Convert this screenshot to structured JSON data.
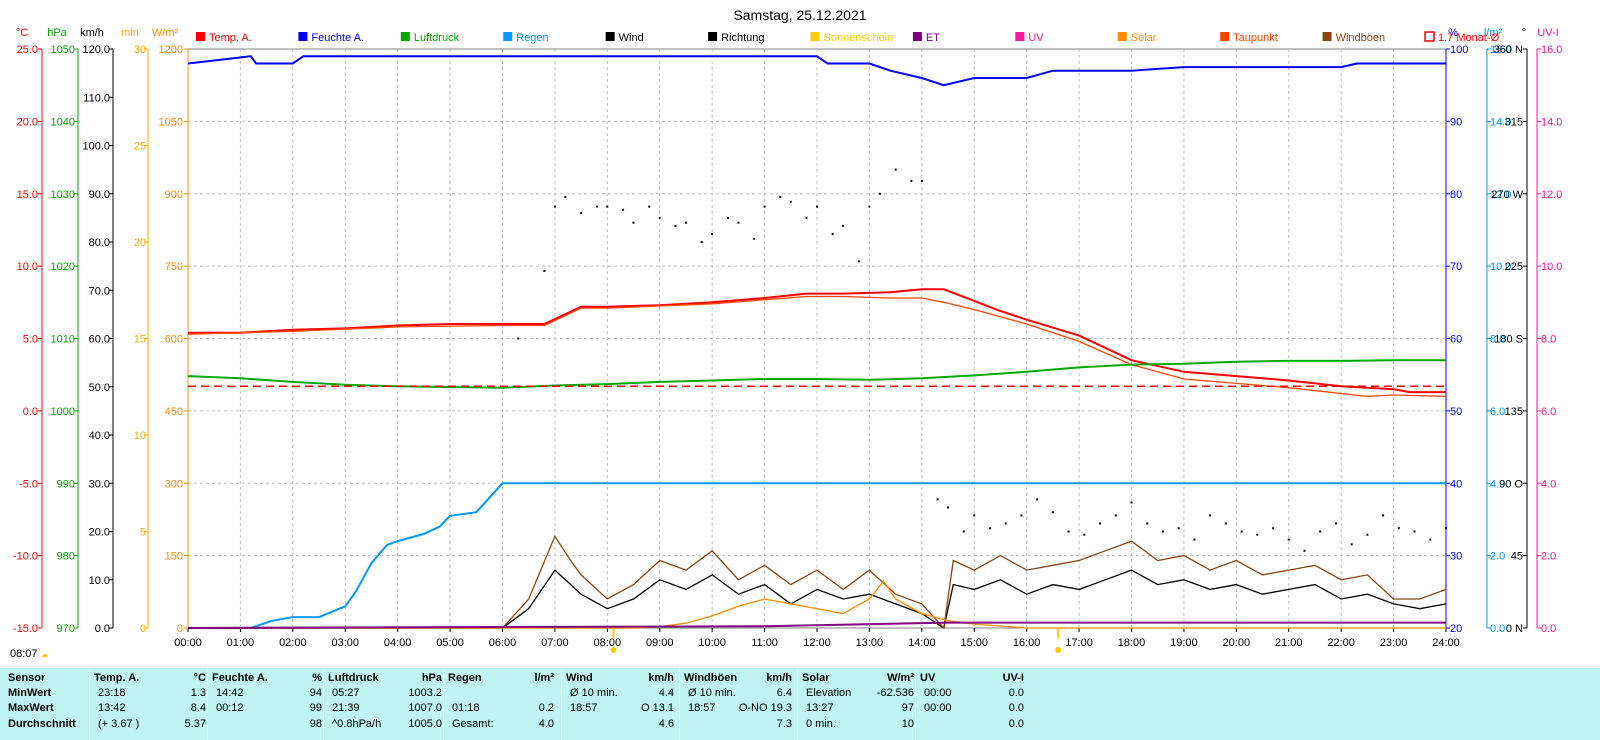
{
  "title": "Samstag, 25.12.2021",
  "sunrise_time": "08:07",
  "legend": [
    {
      "label": "Temp. A.",
      "color": "#ff0000",
      "type": "filled"
    },
    {
      "label": "Feuchte A.",
      "color": "#0000ff",
      "type": "filled"
    },
    {
      "label": "Luftdruck",
      "color": "#00aa00",
      "type": "filled"
    },
    {
      "label": "Regen",
      "color": "#0099ff",
      "type": "filled"
    },
    {
      "label": "Wind",
      "color": "#000000",
      "type": "filled"
    },
    {
      "label": "Richtung",
      "color": "#000000",
      "type": "filled"
    },
    {
      "label": "Sonnenschein",
      "color": "#ffcc00",
      "type": "filled"
    },
    {
      "label": "ET",
      "color": "#800080",
      "type": "filled"
    },
    {
      "label": "UV",
      "color": "#ff1493",
      "type": "filled"
    },
    {
      "label": "Solar",
      "color": "#ff8c00",
      "type": "filled"
    },
    {
      "label": "Taupunkt",
      "color": "#ff4500",
      "type": "filled"
    },
    {
      "label": "Windböen",
      "color": "#8b4513",
      "type": "filled"
    },
    {
      "label": "1.7 Monat-Ø",
      "color": "#ff0000",
      "type": "open"
    }
  ],
  "axes": {
    "temp": {
      "unit": "°C",
      "color": "#ff0000",
      "ticks": [
        "25.0",
        "20.0",
        "15.0",
        "10.0",
        "5.0",
        "0.0",
        "-5.0",
        "-10.0",
        "-15.0"
      ]
    },
    "pressure": {
      "unit": "hPa",
      "color": "#00aa00",
      "ticks": [
        "1050",
        "1040",
        "1030",
        "1020",
        "1010",
        "1000",
        "990",
        "980",
        "970"
      ]
    },
    "wind": {
      "unit": "km/h",
      "color": "#000000",
      "ticks": [
        "120.0",
        "110.0",
        "100.0",
        "90.0",
        "80.0",
        "70.0",
        "60.0",
        "50.0",
        "40.0",
        "30.0",
        "20.0",
        "10.0",
        "0.0"
      ]
    },
    "sunmin": {
      "unit": "min",
      "color": "#ffaa00",
      "ticks": [
        "30",
        "25",
        "20",
        "15",
        "10",
        "5",
        "0"
      ]
    },
    "solar": {
      "unit": "W/m²",
      "color": "#ff8c00",
      "ticks": [
        "1200",
        "1050",
        "900",
        "750",
        "600",
        "450",
        "300",
        "150",
        "0"
      ]
    },
    "humidity": {
      "unit": "%",
      "color": "#0000ff",
      "ticks": [
        "100",
        "90",
        "80",
        "70",
        "60",
        "50",
        "40",
        "30",
        "20"
      ]
    },
    "rain": {
      "unit": "l/m²",
      "color": "#0099ff",
      "ticks": [
        "16.0",
        "14.0",
        "12.0",
        "10.0",
        "8.0",
        "6.0",
        "4.0",
        "2.0",
        "0.0"
      ]
    },
    "direction": {
      "unit": "°",
      "color": "#000000",
      "ticks": [
        "360 N",
        "315",
        "270 W",
        "225",
        "180 S",
        "135",
        "90 O",
        "45",
        "0 N"
      ]
    },
    "uvi": {
      "unit": "UV-I",
      "color": "#ff1493",
      "ticks": [
        "16.0",
        "14.0",
        "12.0",
        "10.0",
        "8.0",
        "6.0",
        "4.0",
        "2.0",
        "0.0"
      ]
    }
  },
  "chart_data": {
    "type": "line",
    "x_labels": [
      "00:00",
      "01:00",
      "02:00",
      "03:00",
      "04:00",
      "05:00",
      "06:00",
      "07:00",
      "08:00",
      "09:00",
      "10:00",
      "11:00",
      "12:00",
      "13:00",
      "14:00",
      "15:00",
      "16:00",
      "17:00",
      "18:00",
      "19:00",
      "20:00",
      "21:00",
      "22:00",
      "23:00",
      "24:00"
    ],
    "xlim": [
      0,
      24
    ],
    "series": [
      {
        "name": "Temp. A.",
        "unit": "°C",
        "color": "#ff0000",
        "x": [
          0,
          1,
          2,
          3,
          4,
          5,
          6,
          6.8,
          7.5,
          8,
          9,
          10,
          11,
          11.8,
          12.5,
          13.4,
          14.0,
          14.42,
          15,
          15.5,
          16,
          17,
          18,
          19,
          20,
          21,
          22,
          23,
          23.3,
          24
        ],
        "y": [
          5.4,
          5.4,
          5.6,
          5.7,
          5.9,
          6.0,
          6.0,
          6.0,
          7.2,
          7.2,
          7.3,
          7.5,
          7.8,
          8.1,
          8.1,
          8.2,
          8.4,
          8.4,
          7.6,
          6.9,
          6.3,
          5.2,
          3.5,
          2.7,
          2.4,
          2.1,
          1.7,
          1.5,
          1.3,
          1.3
        ]
      },
      {
        "name": "Taupunkt",
        "unit": "°C",
        "color": "#ff4500",
        "x": [
          0,
          2,
          4,
          6,
          6.8,
          7.5,
          8,
          10,
          11.8,
          12.5,
          13.4,
          14.0,
          14.42,
          15,
          16,
          17,
          18,
          19,
          20,
          21,
          22,
          22.5,
          23,
          24
        ],
        "y": [
          5.3,
          5.5,
          5.8,
          5.9,
          5.9,
          7.1,
          7.1,
          7.4,
          7.9,
          7.9,
          7.8,
          7.8,
          7.5,
          7.0,
          6.0,
          4.8,
          3.2,
          2.2,
          1.9,
          1.6,
          1.2,
          1.0,
          1.1,
          1.0
        ]
      },
      {
        "name": "Feuchte A.",
        "unit": "%",
        "color": "#0000ff",
        "x": [
          0,
          1.2,
          1.3,
          2.0,
          2.2,
          3,
          4,
          5,
          6,
          7,
          8,
          9,
          10,
          11,
          12,
          12.2,
          13,
          13.4,
          14,
          14.42,
          15,
          16,
          16.5,
          17,
          18,
          19,
          20,
          21,
          22,
          22.3,
          23,
          24
        ],
        "y": [
          98,
          99,
          98,
          98,
          99,
          99,
          99,
          99,
          99,
          99,
          99,
          99,
          99,
          99,
          99,
          98,
          98,
          97,
          96,
          95,
          96,
          96,
          97,
          97,
          97,
          97.5,
          97.5,
          97.5,
          97.5,
          98,
          98,
          98
        ]
      },
      {
        "name": "Luftdruck",
        "unit": "hPa",
        "color": "#00aa00",
        "x": [
          0,
          1,
          2,
          3,
          4,
          5,
          6,
          7,
          8,
          9,
          10,
          11,
          12,
          13,
          14,
          15,
          16,
          17,
          18,
          19,
          20,
          21,
          22,
          23,
          24
        ],
        "y": [
          1004.8,
          1004.5,
          1004.0,
          1003.6,
          1003.4,
          1003.3,
          1003.2,
          1003.5,
          1003.7,
          1004.0,
          1004.2,
          1004.4,
          1004.4,
          1004.3,
          1004.5,
          1004.9,
          1005.4,
          1006.0,
          1006.4,
          1006.5,
          1006.8,
          1006.9,
          1006.9,
          1007.0,
          1007.0
        ]
      },
      {
        "name": "1.7 Monat-Ø",
        "unit": "°C",
        "color": "#ff0000",
        "style": "dashed",
        "x": [
          0,
          24
        ],
        "y": [
          1.7,
          1.7
        ]
      },
      {
        "name": "Regen",
        "unit": "l/m²",
        "color": "#0099ff",
        "x": [
          0,
          1,
          1.2,
          1.6,
          2.0,
          2.5,
          3.0,
          3.2,
          3.5,
          3.8,
          4.0,
          4.5,
          4.8,
          5.0,
          5.5,
          6.0,
          24
        ],
        "y": [
          0,
          0,
          0.0,
          0.2,
          0.3,
          0.3,
          0.6,
          1.0,
          1.8,
          2.3,
          2.4,
          2.6,
          2.8,
          3.1,
          3.2,
          4.0,
          4.0
        ]
      },
      {
        "name": "Wind",
        "unit": "km/h",
        "color": "#000000",
        "x": [
          0,
          6,
          6.5,
          7,
          7.5,
          8,
          8.5,
          9,
          9.5,
          10,
          10.5,
          11,
          11.5,
          12,
          12.5,
          13,
          13.5,
          14,
          14.42,
          14.6,
          15,
          15.5,
          16,
          16.5,
          17,
          17.5,
          18,
          18.5,
          19,
          19.5,
          20,
          20.5,
          21,
          21.5,
          22,
          22.5,
          23,
          23.5,
          24
        ],
        "y": [
          0,
          0,
          4,
          12,
          7,
          4,
          6,
          10,
          8,
          11,
          7,
          9,
          5,
          8,
          6,
          7,
          5,
          3,
          0,
          9,
          8,
          10,
          7,
          9,
          8,
          10,
          12,
          9,
          10,
          8,
          9,
          7,
          8,
          9,
          6,
          7,
          5,
          4,
          5
        ]
      },
      {
        "name": "Windböen",
        "unit": "km/h",
        "color": "#8b4513",
        "x": [
          0,
          6,
          6.5,
          7,
          7.3,
          7.5,
          8,
          8.5,
          9,
          9.5,
          10,
          10.5,
          11,
          11.5,
          12,
          12.5,
          13,
          13.5,
          14,
          14.42,
          14.6,
          15,
          15.5,
          16,
          16.5,
          17,
          17.5,
          18,
          18.5,
          19,
          19.5,
          20,
          20.5,
          21,
          21.5,
          22,
          22.5,
          23,
          23.5,
          24
        ],
        "y": [
          0,
          0,
          6,
          19,
          14,
          11,
          6,
          9,
          14,
          12,
          16,
          10,
          13,
          9,
          12,
          8,
          12,
          7,
          5,
          0,
          14,
          12,
          15,
          12,
          13,
          14,
          16,
          18,
          14,
          15,
          12,
          14,
          11,
          12,
          13,
          10,
          11,
          6,
          6,
          8
        ]
      },
      {
        "name": "Solar",
        "unit": "W/m²",
        "color": "#ff8c00",
        "x": [
          0,
          8.5,
          9,
          9.5,
          10,
          10.5,
          11,
          11.5,
          12,
          12.5,
          13,
          13.27,
          13.5,
          14,
          14.5,
          15,
          16,
          24
        ],
        "y": [
          0,
          0,
          3,
          10,
          25,
          45,
          60,
          50,
          40,
          30,
          60,
          97,
          60,
          30,
          15,
          8,
          0,
          0
        ]
      },
      {
        "name": "ET",
        "unit": "l/m²",
        "color": "#800080",
        "x": [
          0,
          11,
          14.5,
          24
        ],
        "y": [
          0,
          0.05,
          0.15,
          0.15
        ]
      },
      {
        "name": "Richtung",
        "unit": "°",
        "color": "#000000",
        "style": "dots",
        "x": [
          6.3,
          6.8,
          7.0,
          7.2,
          7.5,
          7.8,
          8.0,
          8.3,
          8.5,
          8.8,
          9.0,
          9.3,
          9.5,
          9.8,
          10.0,
          10.3,
          10.5,
          10.8,
          11.0,
          11.3,
          11.5,
          11.8,
          12.0,
          12.3,
          12.5,
          12.8,
          13.0,
          13.2,
          13.5,
          13.8,
          14.0,
          14.3,
          14.5,
          14.8,
          15.0,
          15.3,
          15.6,
          15.9,
          16.2,
          16.5,
          16.8,
          17.1,
          17.4,
          17.7,
          18.0,
          18.3,
          18.6,
          18.9,
          19.2,
          19.5,
          19.8,
          20.1,
          20.4,
          20.7,
          21.0,
          21.3,
          21.6,
          21.9,
          22.2,
          22.5,
          22.8,
          23.1,
          23.4,
          23.7,
          24.0
        ],
        "y": [
          180,
          222,
          262,
          268,
          258,
          262,
          262,
          260,
          252,
          262,
          255,
          250,
          252,
          240,
          245,
          255,
          252,
          242,
          262,
          268,
          265,
          255,
          262,
          245,
          250,
          228,
          262,
          270,
          285,
          278,
          278,
          80,
          75,
          60,
          70,
          62,
          65,
          70,
          80,
          72,
          60,
          58,
          65,
          70,
          78,
          65,
          60,
          62,
          55,
          70,
          65,
          60,
          58,
          62,
          55,
          48,
          60,
          65,
          52,
          58,
          70,
          62,
          60,
          55,
          62
        ]
      }
    ]
  },
  "table": {
    "sensor_col": {
      "header": "Sensor",
      "rows": [
        "MinWert",
        "MaxWert",
        "Durchschnitt"
      ]
    },
    "temp": {
      "title": "Temp. A.",
      "unit": "°C",
      "r1": [
        "23:18",
        "1.3"
      ],
      "r2": [
        "13:42",
        "8.4"
      ],
      "r3": [
        "(+ 3.67 )",
        "5.37"
      ]
    },
    "hum": {
      "title": "Feuchte A.",
      "unit": "%",
      "r1": [
        "14:42",
        "94"
      ],
      "r2": [
        "00:12",
        "99"
      ],
      "r3": [
        "",
        "98"
      ]
    },
    "pres": {
      "title": "Luftdruck",
      "unit": "hPa",
      "r1": [
        "05:27",
        "1003.2"
      ],
      "r2": [
        "21:39",
        "1007.0"
      ],
      "r3": [
        "^0.8hPa/h",
        "1005.0"
      ]
    },
    "rain": {
      "title": "Regen",
      "unit": "l/m²",
      "r1": [
        "",
        ""
      ],
      "r2": [
        "01:18",
        "0.2"
      ],
      "r3": [
        "Gesamt:",
        "4.0"
      ]
    },
    "wind": {
      "title": "Wind",
      "unit": "km/h",
      "r1": [
        "Ø 10 min.",
        "4.4"
      ],
      "r2": [
        "18:57",
        "O 13.1"
      ],
      "r3": [
        "",
        "4.6"
      ]
    },
    "gust": {
      "title": "Windböen",
      "unit": "km/h",
      "r1": [
        "Ø 10 min.",
        "6.4"
      ],
      "r2": [
        "18:57",
        "O-NO 19.3"
      ],
      "r3": [
        "",
        "7.3"
      ]
    },
    "solar": {
      "title": "Solar",
      "unit": "W/m²",
      "r1": [
        "Elevation",
        "-62.536"
      ],
      "r2": [
        "13:27",
        "97"
      ],
      "r3": [
        "0 min.",
        "10"
      ]
    },
    "uv": {
      "title": "UV",
      "unit": "UV-I",
      "r1": [
        "00:00",
        "0.0"
      ],
      "r2": [
        "00:00",
        "0.0"
      ],
      "r3": [
        "",
        "0.0"
      ]
    }
  }
}
